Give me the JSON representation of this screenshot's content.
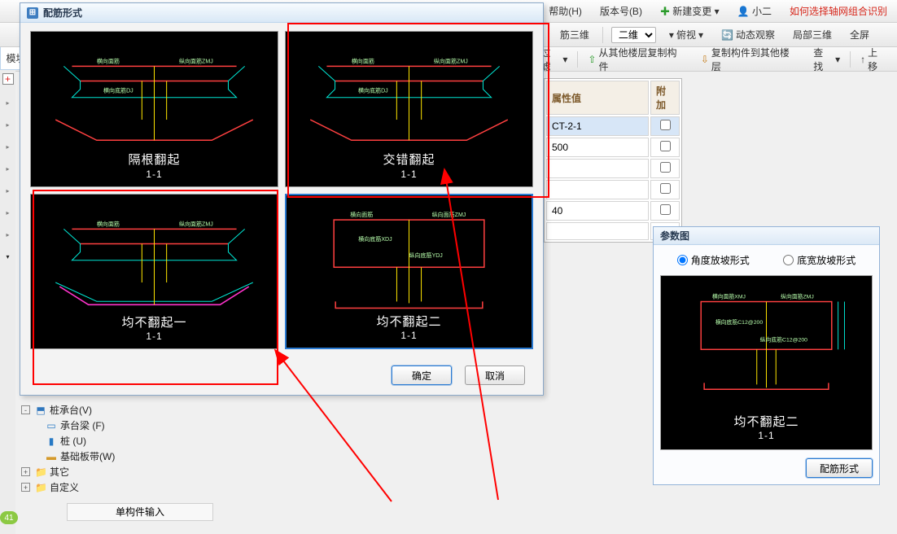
{
  "menu": {
    "help": "帮助(H)",
    "version": "版本号(B)",
    "newchange": "新建变更",
    "user": "小二",
    "redlink": "如何选择轴网组合识别"
  },
  "toolbar2": {
    "rebar3d": "筋三维",
    "view2d": "二维",
    "overlook": "俯视",
    "dynamicview": "动态观察",
    "local3d": "局部三维",
    "fullscreen": "全屏"
  },
  "toolbar3": {
    "filter": "过滤",
    "copyfromother": "从其他楼层复制构件",
    "copytoother": "复制构件到其他楼层",
    "find": "查找",
    "up": "上移"
  },
  "modules_tab": "模块",
  "dialog": {
    "title": "配筋形式",
    "options": [
      {
        "title": "隔根翻起",
        "sub": "1-1"
      },
      {
        "title": "交错翻起",
        "sub": "1-1"
      },
      {
        "title": "均不翻起一",
        "sub": "1-1"
      },
      {
        "title": "均不翻起二",
        "sub": "1-1"
      }
    ],
    "ok": "确定",
    "cancel": "取消"
  },
  "properties": {
    "col_value": "属性值",
    "col_extra": "附加",
    "rows": [
      {
        "value": "CT-2-1",
        "chk": false
      },
      {
        "value": "500",
        "chk": false
      },
      {
        "value": "",
        "chk": false
      },
      {
        "value": "",
        "chk": false
      },
      {
        "value": "40",
        "chk": false
      },
      {
        "value": "",
        "chk": false
      }
    ]
  },
  "tree": {
    "pile_cap": "桩承台(V)",
    "cap_beam": "承台梁 (F)",
    "pile": "桩 (U)",
    "strip_found": "基础板带(W)",
    "other": "其它",
    "custom": "自定义"
  },
  "single_input": "单构件输入",
  "param_panel": {
    "title": "参数图",
    "radio1": "角度放坡形式",
    "radio2": "底宽放坡形式",
    "preview_title": "均不翻起二",
    "preview_sub": "1-1",
    "button": "配筋形式",
    "cad_labels": {
      "hxmj": "横向面筋XMJ",
      "zxmj": "纵向面筋ZMJ",
      "hxdj": "横向底筋C12@200",
      "zxdj": "纵向底筋C12@200"
    }
  },
  "cad_labels": {
    "hxmj": "横向面筋",
    "zxmj": "纵向面筋ZMJ",
    "hxdj": "横向底筋XDJ",
    "zxdj": "纵向底筋YDJ",
    "xdj": "横向底筋DJ"
  },
  "page_badge": "41"
}
